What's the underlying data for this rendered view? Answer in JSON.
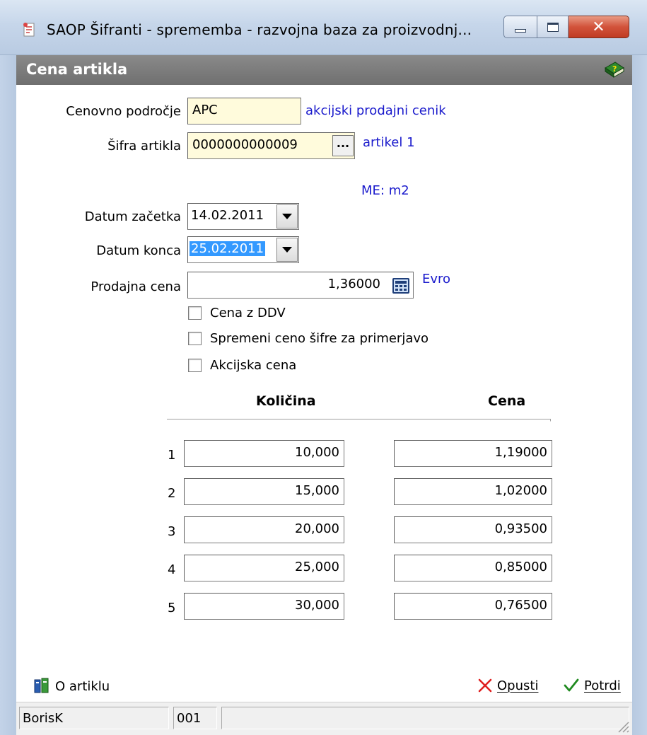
{
  "window": {
    "title": "SAOP Šifranti - sprememba - razvojna baza za proizvodnj..."
  },
  "header": {
    "title": "Cena artikla"
  },
  "form": {
    "cenovno_podrocje_label": "Cenovno področje",
    "cenovno_podrocje_value": "APC",
    "cenovno_podrocje_desc": "akcijski prodajni cenik",
    "sifra_artikla_label": "Šifra artikla",
    "sifra_artikla_value": "0000000000009",
    "sifra_artikla_desc": "artikel 1",
    "browse_label": "...",
    "me_text": "ME: m2",
    "datum_zacetka_label": "Datum začetka",
    "datum_zacetka_value": "14.02.2011",
    "datum_konca_label": "Datum konca",
    "datum_konca_value": "25.02.2011",
    "prodajna_cena_label": "Prodajna cena",
    "prodajna_cena_value": "1,36000",
    "currency": "Evro",
    "checkboxes": [
      {
        "label": "Cena z DDV",
        "checked": false
      },
      {
        "label": "Spremeni ceno šifre za primerjavo",
        "checked": false
      },
      {
        "label": "Akcijska cena",
        "checked": false
      }
    ]
  },
  "table": {
    "col_kolicina": "Količina",
    "col_cena": "Cena",
    "rows": [
      {
        "num": "1",
        "kolicina": "10,000",
        "cena": "1,19000"
      },
      {
        "num": "2",
        "kolicina": "15,000",
        "cena": "1,02000"
      },
      {
        "num": "3",
        "kolicina": "20,000",
        "cena": "0,93500"
      },
      {
        "num": "4",
        "kolicina": "25,000",
        "cena": "0,85000"
      },
      {
        "num": "5",
        "kolicina": "30,000",
        "cena": "0,76500"
      }
    ]
  },
  "actions": {
    "o_artiklu": "O artiklu",
    "opusti": "Opusti",
    "potrdi": "Potrdi"
  },
  "status": {
    "user": "BorisK",
    "code": "001"
  },
  "colors": {
    "link_blue": "#1a1acc",
    "field_yellow": "#fffbdc",
    "header_gray": "#7a7a7a",
    "selection_blue": "#3399ff"
  }
}
